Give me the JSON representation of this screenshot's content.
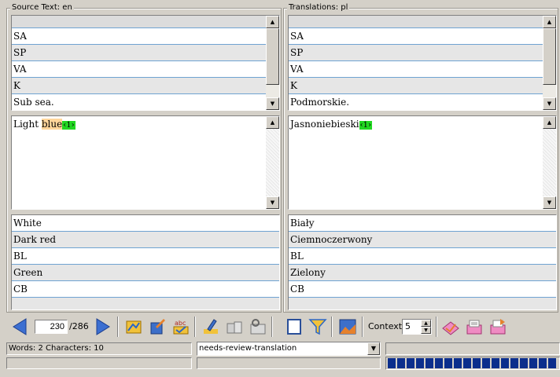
{
  "source_panel": {
    "title": "Source Text: en",
    "rows_top": [
      "SA",
      "SP",
      "VA",
      "K",
      "Sub sea."
    ],
    "editor": {
      "text_plain": "Light ",
      "text_highlight": "blue",
      "tag": "‹1›"
    },
    "rows_bottom": [
      "White",
      "Dark red",
      "BL",
      "Green",
      "CB"
    ]
  },
  "target_panel": {
    "title": "Translations: pl",
    "rows_top": [
      "SA",
      "SP",
      "VA",
      "K",
      "Podmorskie."
    ],
    "editor": {
      "text_plain": "Jasnoniebieski",
      "tag": "‹1›"
    },
    "rows_bottom": [
      "Biały",
      "Ciemnoczerwony",
      "BL",
      "Zielony",
      "CB"
    ]
  },
  "toolbar": {
    "segment_number": "230",
    "segment_total": "/286",
    "context_label": "Context:",
    "context_value": "5",
    "icons": [
      "back-arrow-icon",
      "forward-arrow-icon",
      "copy-source-icon",
      "edit-icon",
      "spellcheck-icon",
      "highlighter-icon",
      "memory-icon",
      "memory-search-icon",
      "document-icon",
      "filter-icon",
      "image-icon",
      "approve-icon",
      "inbox-icon",
      "outbox-icon"
    ]
  },
  "status": {
    "word_count": "Words: 2 Characters: 10",
    "state_value": "needs-review-translation",
    "progress_segments": 18
  },
  "colors": {
    "background": "#d4d0c8",
    "row_line": "#6fa3d2",
    "tag": "#22d822",
    "highlight": "#ffd59a",
    "progress": "#0b2e8c"
  }
}
